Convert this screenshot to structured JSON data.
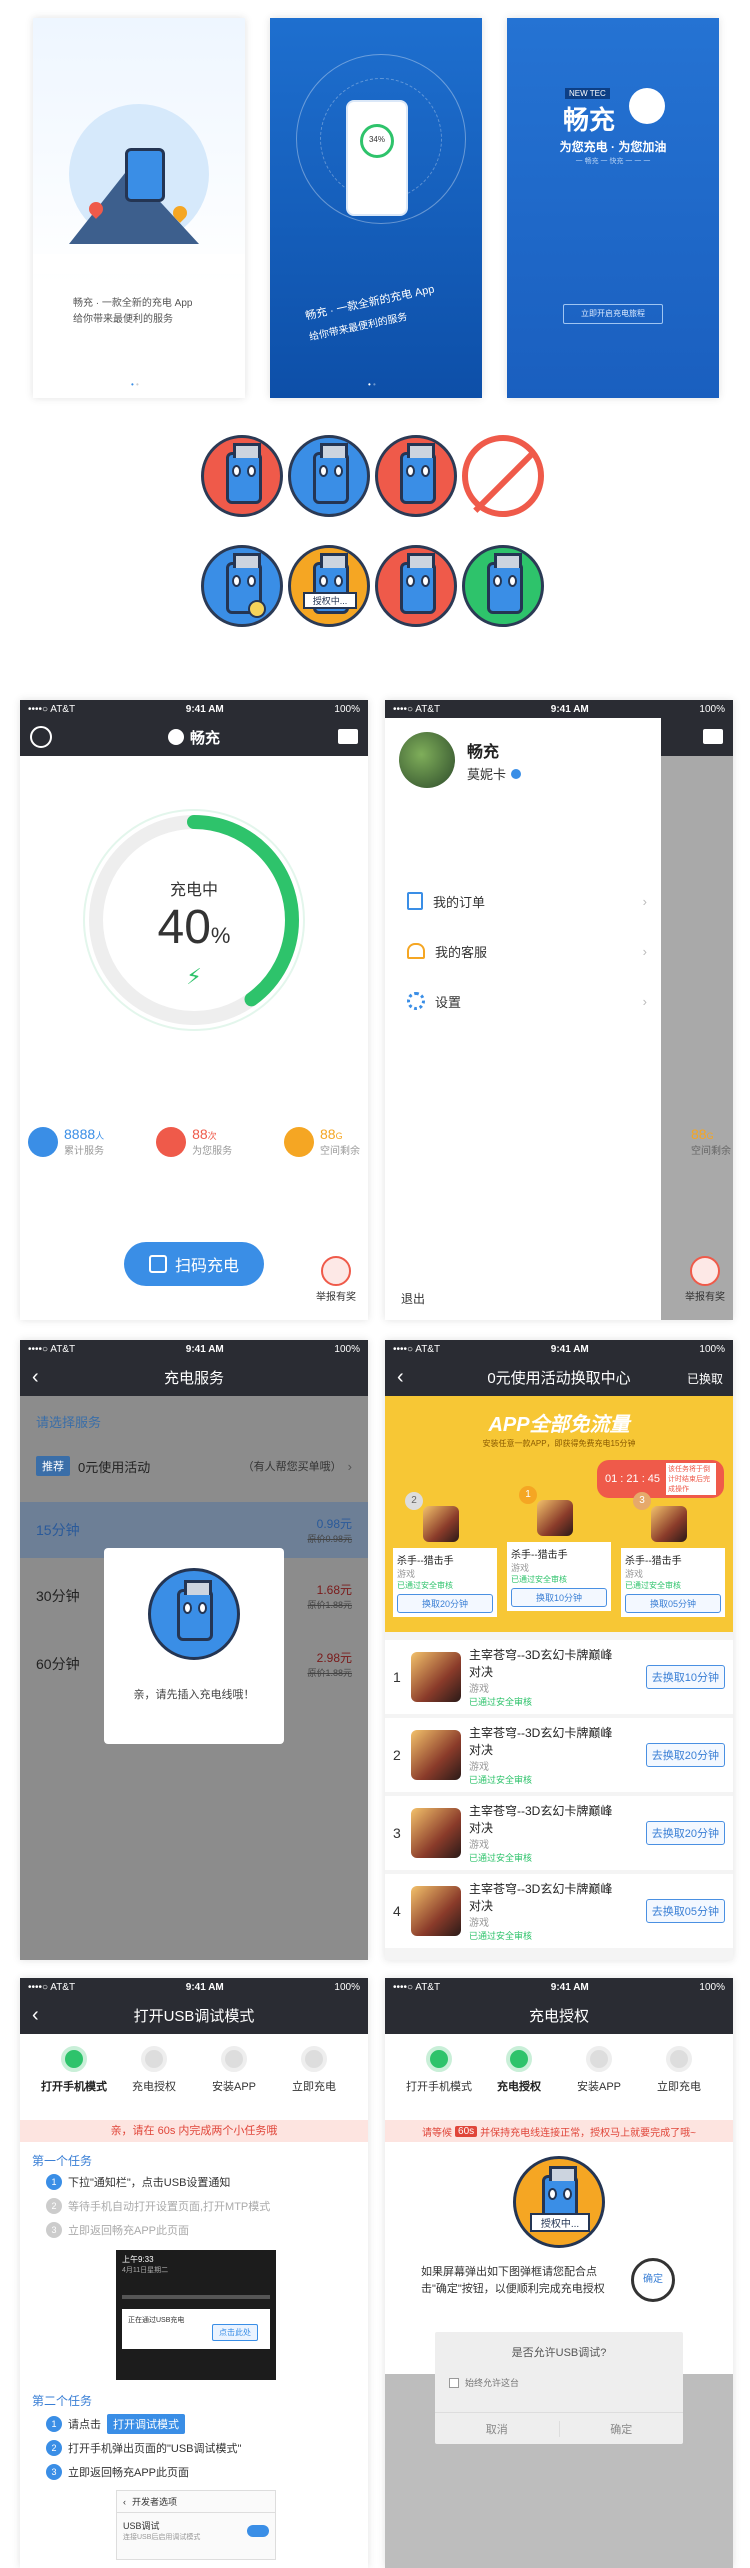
{
  "splash1": {
    "line1": "畅充 · 一款全新的充电 App",
    "line2": "给你带来最便利的服务"
  },
  "splash2": {
    "line1": "畅充 · 一款全新的充电 App",
    "line2": "给你带来最便利的服务",
    "phone_pct": "34%"
  },
  "splash3": {
    "badge": "NEW TEC",
    "brand": "畅充",
    "slogan": "为您充电 · 为您加油",
    "sub": "一 畅充 一 快充 一 一 一",
    "button": "立即开启充电旅程"
  },
  "mascots": {
    "sign_text": "授权中..."
  },
  "status": {
    "carrier": "••••○ AT&T",
    "time": "9:41 AM",
    "battery": "100%"
  },
  "home": {
    "brand": "畅充",
    "charging_label": "充电中",
    "percent": "40",
    "percent_unit": "%",
    "progress": 0.4,
    "stats": [
      {
        "value": "8888",
        "unit": "人",
        "label": "累计服务",
        "color": "#3a8ee6"
      },
      {
        "value": "88",
        "unit": "次",
        "label": "为您服务",
        "color": "#ef5a4a"
      },
      {
        "value": "88",
        "unit": "G",
        "label": "空间剩余",
        "color": "#f5a623"
      }
    ],
    "scan_button": "扫码充电",
    "report_label": "举报有奖"
  },
  "drawer": {
    "title": "畅充",
    "username": "莫妮卡",
    "menu": [
      "我的订单",
      "我的客服",
      "设置"
    ],
    "logout": "退出",
    "bg_stat": "88",
    "bg_stat_unit": "G",
    "bg_stat_label": "空间剩余",
    "report_label": "举报有奖"
  },
  "service": {
    "title": "充电服务",
    "section": "请选择服务",
    "tag": "推荐",
    "free_item": "0元使用活动",
    "free_note": "（有人帮您买单哦）",
    "plans": [
      {
        "name": "15分钟",
        "price": "0.98元",
        "orig": "原价0.98元"
      },
      {
        "name": "30分钟",
        "price": "1.68元",
        "orig": "原价1.88元"
      },
      {
        "name": "60分钟",
        "price": "2.98元",
        "orig": "原价1.88元"
      }
    ],
    "modal_text": "亲，请先插入充电线哦！"
  },
  "activity": {
    "title": "0元使用活动换取中心",
    "right": "已换取",
    "banner_title": "APP全部免流量",
    "banner_sub": "安装任意一款APP，即获得免费充电15分钟",
    "timer": "01 : 21 : 45",
    "timer_note": "该任务将于倒计时结束后完成操作",
    "top_games": [
      {
        "rank": "2",
        "name": "杀手--猎击手",
        "cat": "游戏",
        "verified": "已通过安全审核",
        "button": "换取20分钟"
      },
      {
        "rank": "1",
        "name": "杀手--猎击手",
        "cat": "游戏",
        "verified": "已通过安全审核",
        "button": "换取10分钟"
      },
      {
        "rank": "3",
        "name": "杀手--猎击手",
        "cat": "游戏",
        "verified": "已通过安全审核",
        "button": "换取05分钟"
      }
    ],
    "list": [
      {
        "rank": "1",
        "name": "主宰苍穹--3D玄幻卡牌巅峰对决",
        "cat": "游戏",
        "verified": "已通过安全审核",
        "button": "去换取10分钟"
      },
      {
        "rank": "2",
        "name": "主宰苍穹--3D玄幻卡牌巅峰对决",
        "cat": "游戏",
        "verified": "已通过安全审核",
        "button": "去换取20分钟"
      },
      {
        "rank": "3",
        "name": "主宰苍穹--3D玄幻卡牌巅峰对决",
        "cat": "游戏",
        "verified": "已通过安全审核",
        "button": "去换取20分钟"
      },
      {
        "rank": "4",
        "name": "主宰苍穹--3D玄幻卡牌巅峰对决",
        "cat": "游戏",
        "verified": "已通过安全审核",
        "button": "去换取05分钟"
      }
    ]
  },
  "usb": {
    "title": "打开USB调试模式",
    "steps": [
      "打开手机模式",
      "充电授权",
      "安装APP",
      "立即充电"
    ],
    "alert": "亲，请在 60s 内完成两个小任务哦",
    "task1_title": "第一个任务",
    "task1_items": [
      "下拉\"通知栏\"，点击USB设置通知",
      "等待手机自动打开设置页面,打开MTP模式",
      "立即返回畅充APP此页面"
    ],
    "shot_time": "上午9:33",
    "shot_date": "4月11日星期二",
    "shot_notice": "正在通过USB充电",
    "shot_tip": "点击此处",
    "task2_title": "第二个任务",
    "task2_items": [
      "请点击",
      "打开手机弹出页面的\"USB调试模式\"",
      "立即返回畅充APP此页面"
    ],
    "task2_button": "打开调试模式",
    "dev_title": "开发者选项",
    "dev_item": "USB调试",
    "dev_sub": "连接USB后启用调试模式"
  },
  "auth": {
    "title": "充电授权",
    "steps": [
      "打开手机模式",
      "充电授权",
      "安装APP",
      "立即充电"
    ],
    "alert_pre": "请等候",
    "alert_secs": "60s",
    "alert_post": "并保持充电线连接正常，授权马上就要完成了哦~",
    "desc": "如果屏幕弹出如下图弹框请您配合点击\"确定\"按钮，以便顺利完成充电授权",
    "magnifier": "确定",
    "dialog_title": "是否允许USB调试?",
    "dialog_check": "始终允许这台",
    "cancel": "取消",
    "ok": "确定"
  }
}
